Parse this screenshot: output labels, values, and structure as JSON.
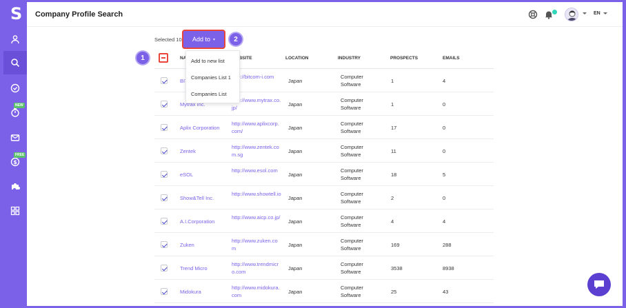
{
  "app": {
    "logo": "S",
    "title": "Company Profile Search",
    "language": "EN"
  },
  "sidebar": {
    "items": [
      {
        "icon": "user-icon"
      },
      {
        "icon": "search-icon",
        "active": true
      },
      {
        "icon": "check-circle-icon"
      },
      {
        "icon": "timer-icon",
        "badge": "NEW"
      },
      {
        "icon": "mail-icon"
      },
      {
        "icon": "dollar-icon",
        "badge": "FREE"
      },
      {
        "icon": "puzzle-icon"
      },
      {
        "icon": "apps-icon"
      }
    ]
  },
  "toolbar": {
    "selected_text": "Selected 10",
    "add_to_label": "Add to"
  },
  "steps": [
    "1",
    "2"
  ],
  "dropdown": {
    "items": [
      "Add to new list",
      "Companies List 1",
      "Companies List"
    ]
  },
  "table": {
    "headers": [
      "NAME",
      "WEBSITE",
      "LOCATION",
      "INDUSTRY",
      "PROSPECTS",
      "EMAILS"
    ],
    "rows": [
      {
        "name": "BITcom",
        "website": "http://bitcom-i.com",
        "location": "Japan",
        "industry": "Computer Software",
        "prospects": "1",
        "emails": "4"
      },
      {
        "name": "Mytrax Inc.",
        "website": "http://www.mytrax.co.jp/",
        "location": "Japan",
        "industry": "Computer Software",
        "prospects": "1",
        "emails": "0"
      },
      {
        "name": "Aplix Corporation",
        "website": "http://www.aplixcorp.com/",
        "location": "Japan",
        "industry": "Computer Software",
        "prospects": "17",
        "emails": "0"
      },
      {
        "name": "Zentek",
        "website": "http://www.zentek.com.sg",
        "location": "Japan",
        "industry": "Computer Software",
        "prospects": "11",
        "emails": "0"
      },
      {
        "name": "eSOL",
        "website": "http://www.esol.com",
        "location": "Japan",
        "industry": "Computer Software",
        "prospects": "18",
        "emails": "5"
      },
      {
        "name": "Show&Tell Inc.",
        "website": "http://www.showtell.io",
        "location": "Japan",
        "industry": "Computer Software",
        "prospects": "2",
        "emails": "0"
      },
      {
        "name": "A.I.Corporation",
        "website": "http://www.aicp.co.jp/",
        "location": "Japan",
        "industry": "Computer Software",
        "prospects": "4",
        "emails": "4"
      },
      {
        "name": "Zuken",
        "website": "http://www.zuken.com",
        "location": "Japan",
        "industry": "Computer Software",
        "prospects": "169",
        "emails": "288"
      },
      {
        "name": "Trend Micro",
        "website": "http://www.trendmicro.com",
        "location": "Japan",
        "industry": "Computer Software",
        "prospects": "3538",
        "emails": "8938"
      },
      {
        "name": "Midokura",
        "website": "http://www.midokura.com",
        "location": "Japan",
        "industry": "Computer Software",
        "prospects": "25",
        "emails": "43"
      }
    ]
  },
  "colors": {
    "brand": "#7b61e8",
    "highlight": "#e8443a",
    "notification": "#2fd7b8"
  }
}
